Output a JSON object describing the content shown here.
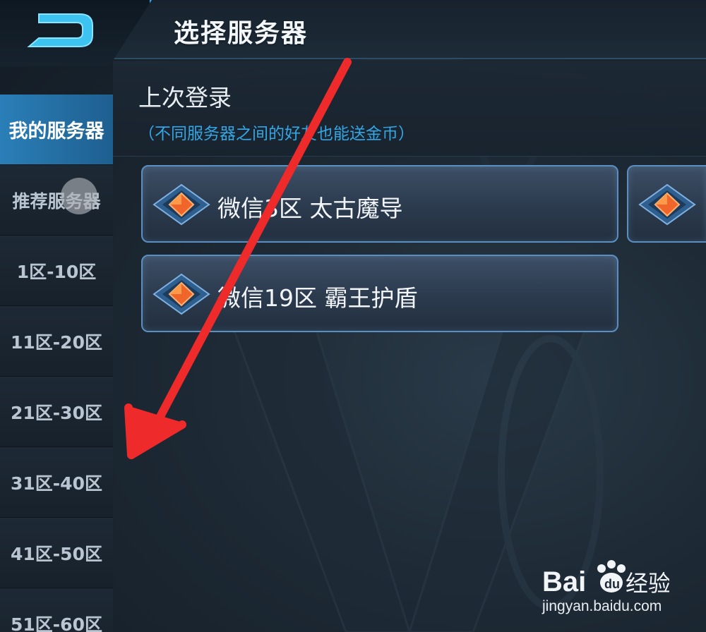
{
  "header": {
    "title": "选择服务器"
  },
  "sidebar": {
    "items": [
      {
        "label": "我的服务器",
        "active": true
      },
      {
        "label": "推荐服务器",
        "active": false
      },
      {
        "label": "1区-10区",
        "active": false
      },
      {
        "label": "11区-20区",
        "active": false
      },
      {
        "label": "21区-30区",
        "active": false
      },
      {
        "label": "31区-40区",
        "active": false
      },
      {
        "label": "41区-50区",
        "active": false
      },
      {
        "label": "51区-60区",
        "active": false
      }
    ]
  },
  "recent": {
    "title": "上次登录",
    "note": "（不同服务器之间的好友也能送金币）"
  },
  "servers": [
    {
      "name": "微信3区 太古魔导",
      "icon": "diamond-gem-icon"
    },
    {
      "name": "微信19区 霸王护盾",
      "icon": "diamond-gem-icon"
    },
    {
      "name": "",
      "icon": "diamond-gem-icon"
    }
  ],
  "watermark": {
    "url": "jingyan.baidu.com"
  },
  "colors": {
    "accent": "#2a7fb8",
    "note": "#33a6e3",
    "arrow": "#ef2a2a",
    "card_border": "#5b8fc2",
    "gem": "#f0662a"
  }
}
